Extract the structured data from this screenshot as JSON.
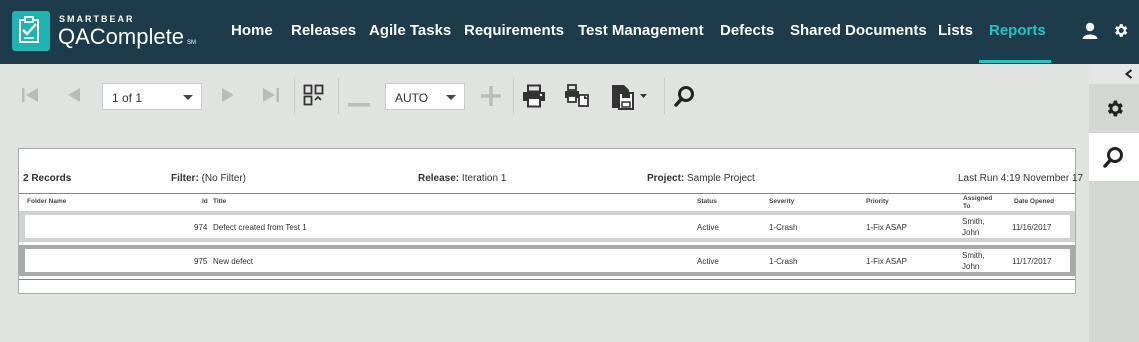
{
  "brand": {
    "company": "SMARTBEAR",
    "product": "QAComplete",
    "tm": "SM"
  },
  "nav": {
    "items": [
      {
        "label": "Home"
      },
      {
        "label": "Releases"
      },
      {
        "label": "Agile Tasks"
      },
      {
        "label": "Requirements"
      },
      {
        "label": "Test Management"
      },
      {
        "label": "Defects"
      },
      {
        "label": "Shared Documents"
      },
      {
        "label": "Lists"
      },
      {
        "label": "Reports"
      }
    ],
    "active": "Reports"
  },
  "toolbar": {
    "page_select": "1 of 1",
    "zoom_select": "AUTO"
  },
  "report": {
    "records": "2 Records",
    "filter_label": "Filter:",
    "filter_value": "(No Filter)",
    "release_label": "Release:",
    "release_value": "Iteration 1",
    "project_label": "Project:",
    "project_value": "Sample Project",
    "last_run": "Last Run 4:19 November 17",
    "columns": {
      "folder": "Folder Name",
      "id": "Id",
      "title": "Title",
      "status": "Status",
      "severity": "Severity",
      "priority": "Priority",
      "assigned": "Assigned To",
      "date": "Date Opened"
    },
    "rows": [
      {
        "id": "974",
        "title": "Defect created from Test 1",
        "status": "Active",
        "severity": "1-Crash",
        "priority": "1-Fix ASAP",
        "assigned": "Smith, John",
        "date": "11/16/2017"
      },
      {
        "id": "975",
        "title": "New defect",
        "status": "Active",
        "severity": "1-Crash",
        "priority": "1-Fix ASAP",
        "assigned": "Smith, John",
        "date": "11/17/2017"
      }
    ]
  },
  "colors": {
    "nav_bg": "#1d3b4b",
    "accent": "#1fc6c6",
    "logo": "#1fb3b3"
  },
  "icons": [
    "user-icon",
    "settings-gear-icon",
    "first-page-icon",
    "prev-page-icon",
    "next-page-icon",
    "last-page-icon",
    "page-layout-icon",
    "zoom-out-icon",
    "zoom-in-icon",
    "print-icon",
    "print-layout-icon",
    "export-icon",
    "search-icon",
    "collapse-chevron-icon"
  ]
}
